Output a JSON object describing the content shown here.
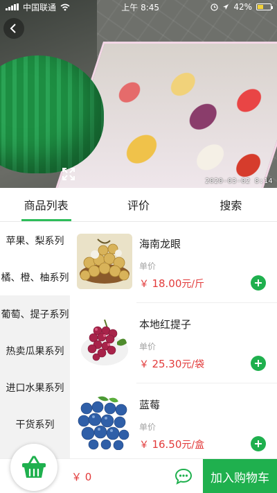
{
  "status_bar": {
    "carrier": "中国联通",
    "time": "上午 8:45",
    "battery": "42%"
  },
  "video": {
    "timestamp": "2020-03-02 8:14"
  },
  "tabs": [
    {
      "label": "商品列表",
      "active": true
    },
    {
      "label": "评价",
      "active": false
    },
    {
      "label": "搜索",
      "active": false
    }
  ],
  "categories": [
    {
      "label": "苹果、梨系列",
      "active": true
    },
    {
      "label": "橘、橙、柚系列",
      "active": true
    },
    {
      "label": "葡萄、提子系列",
      "active": false
    },
    {
      "label": "热卖瓜果系列",
      "active": false
    },
    {
      "label": "进口水果系列",
      "active": false
    },
    {
      "label": "干货系列",
      "active": false
    }
  ],
  "products": [
    {
      "name": "海南龙眼",
      "unit_label": "单价",
      "currency": "￥",
      "price": "18.00",
      "unit": "元/斤",
      "image": "longan"
    },
    {
      "name": "本地红提子",
      "unit_label": "单价",
      "currency": "￥",
      "price": "25.30",
      "unit": "元/袋",
      "image": "red-grapes"
    },
    {
      "name": "蓝莓",
      "unit_label": "单价",
      "currency": "￥",
      "price": "16.50",
      "unit": "元/盒",
      "image": "blueberries"
    }
  ],
  "cart": {
    "total": "￥ 0",
    "checkout_label": "加入购物车"
  },
  "colors": {
    "accent": "#1fb04e",
    "price": "#e23a3a",
    "sidebar_bg": "#f2f2f2"
  }
}
